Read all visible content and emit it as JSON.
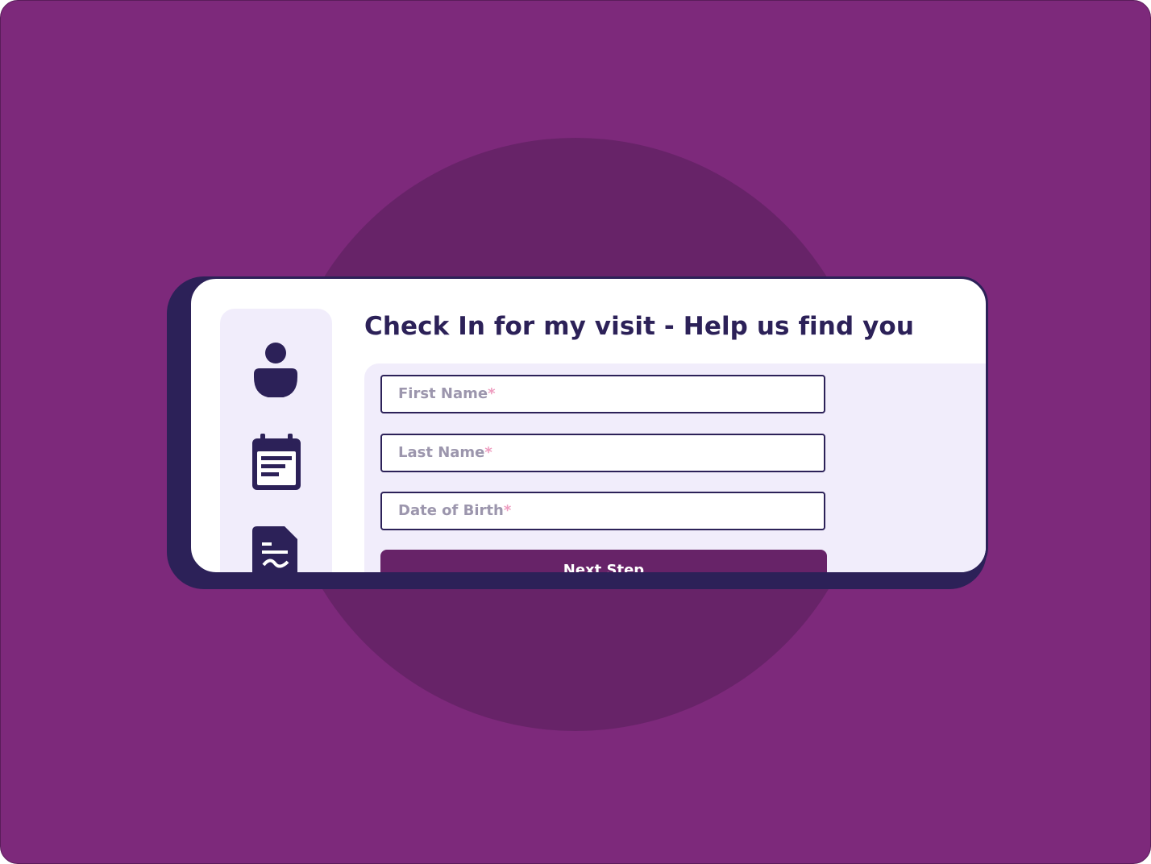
{
  "page": {
    "title": "Check In for my visit - Help us find you"
  },
  "sidebar": {
    "items": [
      {
        "icon": "user-icon"
      },
      {
        "icon": "calendar-icon"
      },
      {
        "icon": "signed-document-icon"
      }
    ]
  },
  "form": {
    "fields": [
      {
        "placeholder": "First Name",
        "required_mark": "*"
      },
      {
        "placeholder": "Last Name",
        "required_mark": "*"
      },
      {
        "placeholder": "Date of Birth",
        "required_mark": "*"
      }
    ],
    "next_button_label": "Next Step"
  },
  "colors": {
    "background": "#7d297b",
    "circle": "#672368",
    "navy": "#2c2158",
    "panel": "#f1edfb",
    "placeholder": "#9c96ad",
    "required": "#ee9cbf",
    "button": "#672368"
  }
}
